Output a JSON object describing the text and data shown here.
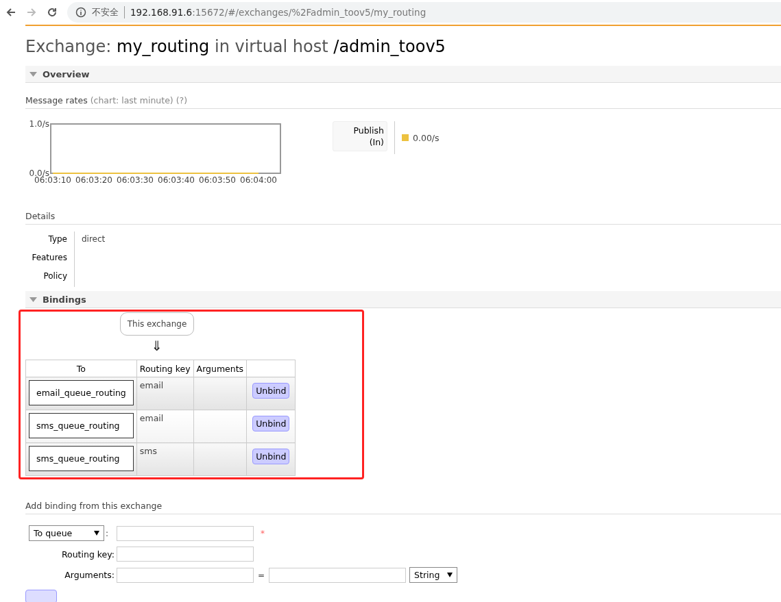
{
  "browser": {
    "security_label": "不安全",
    "url_host": "192.168.91.6",
    "url_rest": ":15672/#/exchanges/%2Fadmin_toov5/my_routing"
  },
  "title": {
    "prefix": "Exchange:",
    "name": "my_routing",
    "middle": "in virtual host",
    "vhost": "/admin_toov5"
  },
  "overview": {
    "header": "Overview",
    "expanded": true,
    "rates_title": "Message rates",
    "rates_note": "(chart: last minute)",
    "help": "(?)",
    "chart_data": {
      "type": "line",
      "x": [
        "06:03:10",
        "06:03:20",
        "06:03:30",
        "06:03:40",
        "06:03:50",
        "06:04:00"
      ],
      "ylim": [
        0,
        1
      ],
      "yticks": [
        {
          "value": 0,
          "label": "0.0/s"
        },
        {
          "value": 1,
          "label": "1.0/s"
        }
      ],
      "series": [
        {
          "color": "#edc240",
          "values": [
            0,
            0,
            0,
            0,
            0,
            0
          ]
        }
      ]
    },
    "legend": [
      {
        "label": "Publish",
        "sublabel": "(In)",
        "color": "#edc240",
        "reading": "0.00/s"
      }
    ],
    "details_title": "Details",
    "details": [
      {
        "label": "Type",
        "value": "direct"
      },
      {
        "label": "Features"
      },
      {
        "label": "Policy"
      }
    ]
  },
  "bindings": {
    "header": "Bindings",
    "expanded": true,
    "source": "This exchange",
    "arrow": "⇓",
    "columns": [
      "To",
      "Routing key",
      "Arguments"
    ],
    "rows": [
      {
        "to": "email_queue_routing",
        "routing_key": "email",
        "action": "Unbind"
      },
      {
        "to": "sms_queue_routing",
        "routing_key": "email",
        "action": "Unbind"
      },
      {
        "to": "sms_queue_routing",
        "routing_key": "sms",
        "action": "Unbind"
      }
    ]
  },
  "add_binding": {
    "title": "Add binding from this exchange",
    "destination": "To queue",
    "required_mark": "*",
    "routing_key_label": "Routing key:",
    "arguments_label": "Arguments:",
    "equals": "=",
    "arg_type": "String",
    "colon": ":"
  }
}
